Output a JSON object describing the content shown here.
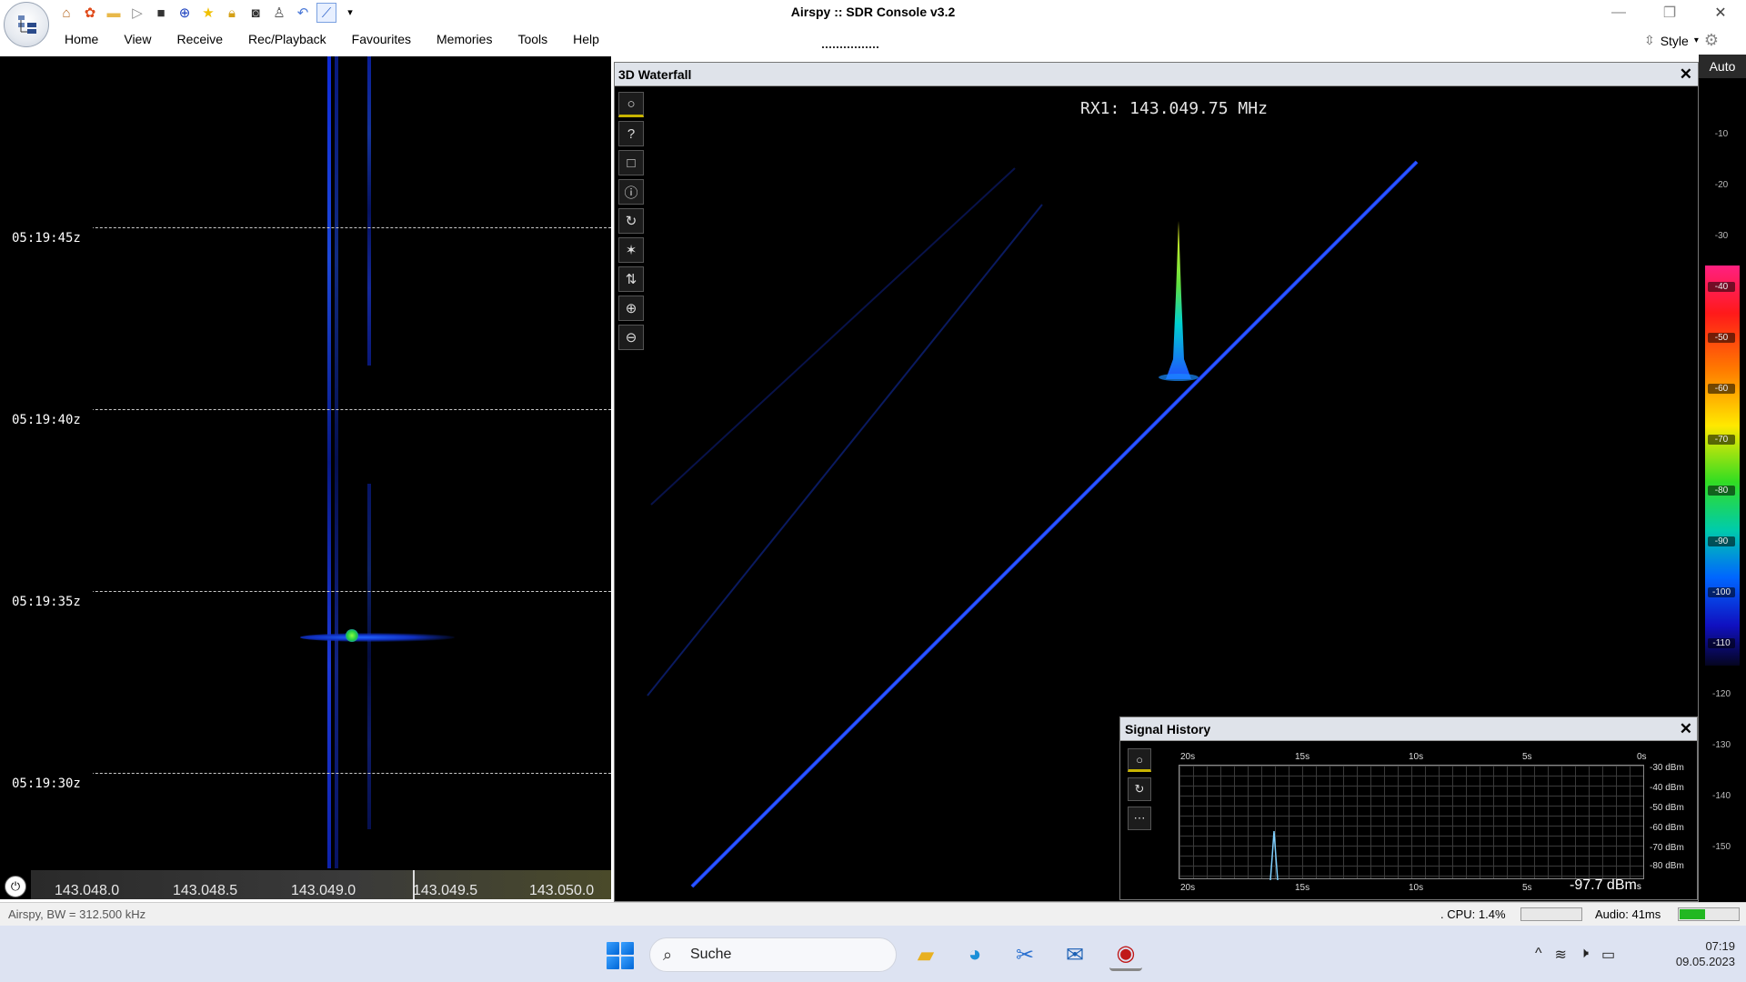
{
  "window": {
    "title": "Airspy :: SDR Console v3.2",
    "controls": [
      "minimize",
      "restore",
      "close"
    ]
  },
  "quick_access_icons": [
    "home-icon",
    "lifebuoy-icon",
    "folder-icon",
    "play-icon",
    "stop-icon",
    "plus-circle-icon",
    "star-icon",
    "lock-icon",
    "camera-icon",
    "user-icon",
    "undo-icon",
    "graph-icon",
    "dropdown-icon"
  ],
  "menu": {
    "items": [
      "Home",
      "View",
      "Receive",
      "Rec/Playback",
      "Favourites",
      "Memories",
      "Tools",
      "Help"
    ],
    "style_label": "Style"
  },
  "waterfall": {
    "time_labels": [
      "05:19:45z",
      "05:19:40z",
      "05:19:35z",
      "05:19:30z"
    ],
    "frequency_ticks": [
      "143.048.0",
      "143.048.5",
      "143.049.0",
      "143.049.5",
      "143.050.0"
    ]
  },
  "panel3d": {
    "title": "3D Waterfall",
    "rx_readout": "RX1: 143.049.75 MHz",
    "tools": [
      {
        "icon": "circle-icon",
        "glyph": "○"
      },
      {
        "icon": "help-icon",
        "glyph": "?"
      },
      {
        "icon": "square-icon",
        "glyph": "□"
      },
      {
        "icon": "info-icon",
        "glyph": "ⓘ"
      },
      {
        "icon": "rotate-icon",
        "glyph": "↻"
      },
      {
        "icon": "asterisk-icon",
        "glyph": "✶"
      },
      {
        "icon": "up-down-arrows-icon",
        "glyph": "⇅"
      },
      {
        "icon": "zoom-in-icon",
        "glyph": "⊕"
      },
      {
        "icon": "zoom-out-icon",
        "glyph": "⊖"
      }
    ]
  },
  "colour_scale": {
    "auto_label": "Auto",
    "ticks": [
      "-10",
      "-20",
      "-30",
      "-40",
      "-50",
      "-60",
      "-70",
      "-80",
      "-90",
      "-100",
      "-110",
      "-120",
      "-130",
      "-140",
      "-150"
    ]
  },
  "signal_history": {
    "title": "Signal History",
    "x_ticks": [
      "20s",
      "15s",
      "10s",
      "5s",
      "0s"
    ],
    "y_ticks": [
      "-30 dBm",
      "-40 dBm",
      "-50 dBm",
      "-60 dBm",
      "-70 dBm",
      "-80 dBm"
    ],
    "value": "-97.7 dBm",
    "value_suffix": "s"
  },
  "status": {
    "left": "Airspy, BW = 312.500 kHz",
    "cpu": ". CPU: 1.4%",
    "audio": "Audio: 41ms",
    "audio_level": 0.42
  },
  "taskbar": {
    "search_placeholder": "Suche",
    "apps": [
      "file-explorer-icon",
      "edge-icon",
      "snipping-tool-icon",
      "mail-icon",
      "sdr-console-icon"
    ],
    "time": "07:19",
    "date": "09.05.2023"
  }
}
